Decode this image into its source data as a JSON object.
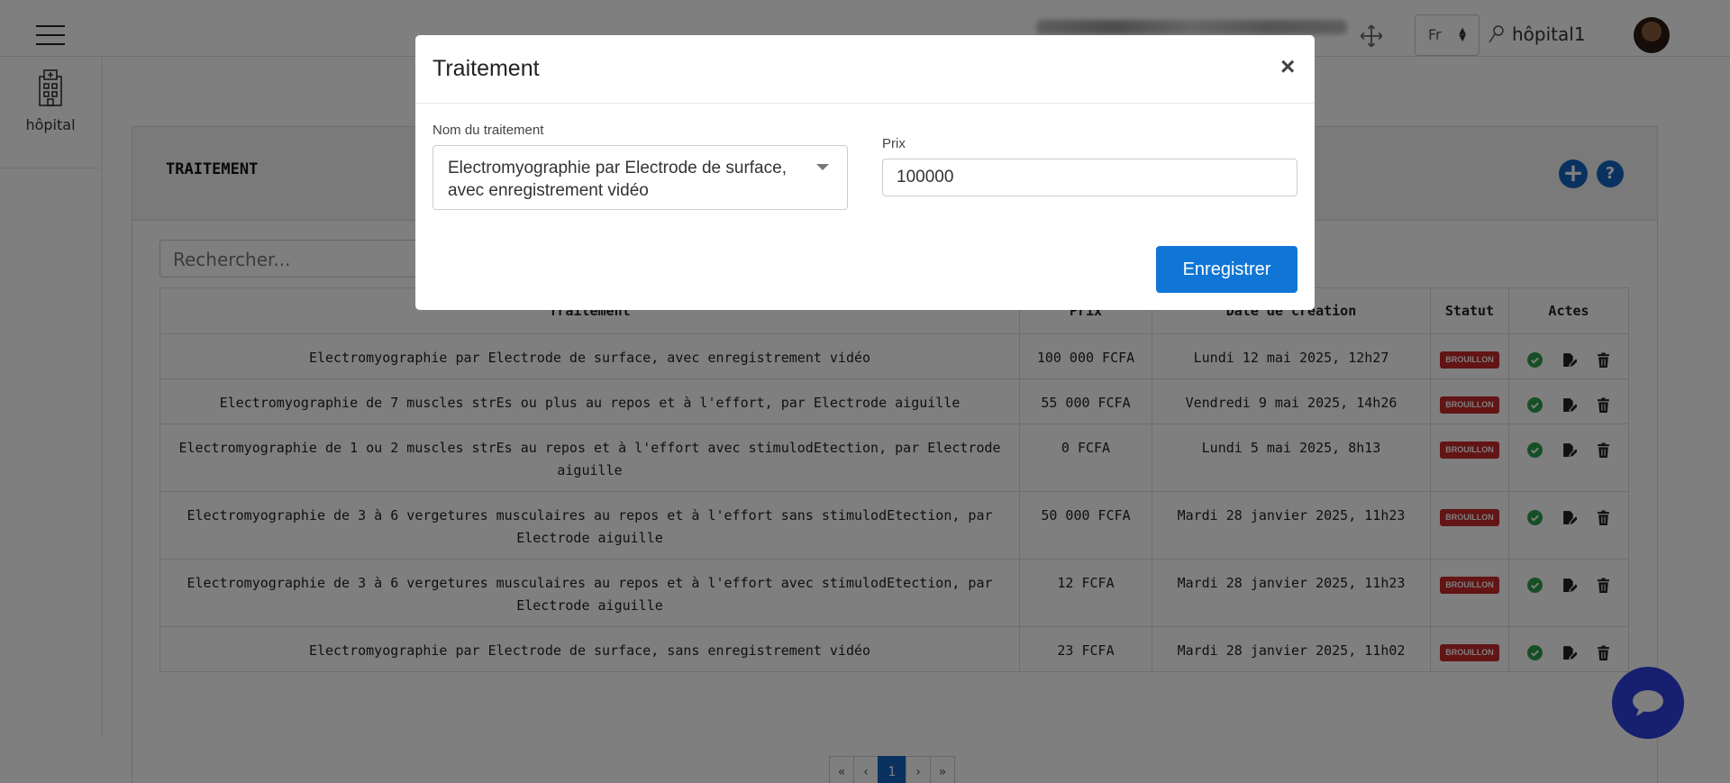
{
  "header": {
    "language": "Fr",
    "username": "hôpital1"
  },
  "sidebar": {
    "items": [
      {
        "label": "hôpital",
        "icon": "hospital-icon"
      }
    ]
  },
  "card": {
    "title": "TRAITEMENT",
    "search_placeholder": "Rechercher..."
  },
  "table": {
    "headers": [
      "Traitement",
      "Prix",
      "Date de création",
      "Statut",
      "Actes"
    ],
    "rows": [
      {
        "traitement": "Electromyographie par Electrode de surface, avec enregistrement vidéo",
        "prix": "100 000 FCFA",
        "date": "Lundi 12 mai 2025, 12h27",
        "statut": "BROUILLON"
      },
      {
        "traitement": "Electromyographie de 7 muscles strEs ou plus au repos et à l'effort, par Electrode aiguille",
        "prix": "55 000 FCFA",
        "date": "Vendredi 9 mai 2025, 14h26",
        "statut": "BROUILLON"
      },
      {
        "traitement": "Electromyographie de 1 ou 2 muscles strEs au repos et à l'effort avec stimulodEtection, par Electrode aiguille",
        "prix": "0 FCFA",
        "date": "Lundi 5 mai 2025, 8h13",
        "statut": "BROUILLON"
      },
      {
        "traitement": "Electromyographie de 3 à 6 vergetures musculaires au repos et à l'effort sans stimulodEtection, par Electrode aiguille",
        "prix": "50 000 FCFA",
        "date": "Mardi 28 janvier 2025, 11h23",
        "statut": "BROUILLON"
      },
      {
        "traitement": "Electromyographie de 3 à 6 vergetures musculaires au repos et à l'effort avec stimulodEtection, par Electrode aiguille",
        "prix": "12 FCFA",
        "date": "Mardi 28 janvier 2025, 11h23",
        "statut": "BROUILLON"
      },
      {
        "traitement": "Electromyographie par Electrode de surface, sans enregistrement vidéo",
        "prix": "23 FCFA",
        "date": "Mardi 28 janvier 2025, 11h02",
        "statut": "BROUILLON"
      }
    ]
  },
  "pagination": {
    "first": "«",
    "prev": "‹",
    "current": "1",
    "next": "›",
    "last": "»"
  },
  "modal": {
    "title": "Traitement",
    "close": "×",
    "name_label": "Nom du traitement",
    "name_value": "Electromyographie par Electrode de surface, avec enregistrement vidéo",
    "price_label": "Prix",
    "price_value": "100000",
    "save_label": "Enregistrer"
  },
  "colors": {
    "primary": "#1076d6",
    "badge": "#c62828",
    "check": "#2e9e4a",
    "chat": "#2f3fe0"
  }
}
